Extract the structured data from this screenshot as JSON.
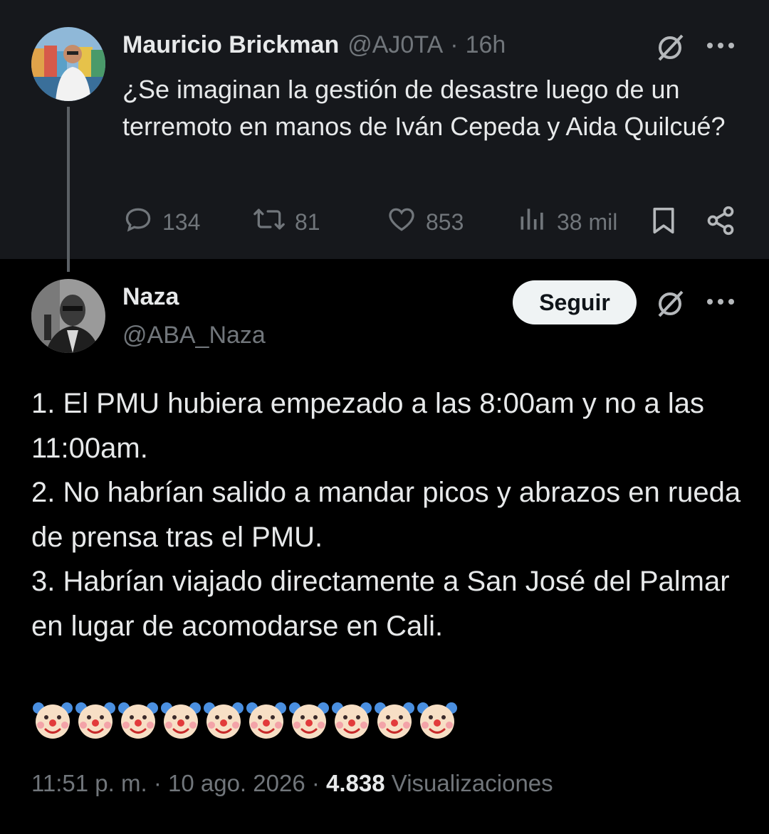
{
  "quoted_tweet": {
    "author_name": "Mauricio Brickman",
    "author_handle": "@AJ0TA",
    "separator": "·",
    "time": "16h",
    "text": "¿Se imaginan la gestión de desastre luego de un terremoto en manos de Iván Cepeda y Aida Quilcué?",
    "replies": "134",
    "reposts": "81",
    "likes": "853",
    "views": "38 mil",
    "icons": [
      "grok-icon",
      "more-icon",
      "reply-icon",
      "repost-icon",
      "like-icon",
      "views-icon",
      "bookmark-icon",
      "share-icon"
    ]
  },
  "main_tweet": {
    "author_name": "Naza",
    "author_handle": "@ABA_Naza",
    "follow_label": "Seguir",
    "lines": [
      "1. El PMU hubiera empezado a las 8:00am y no a las 11:00am.",
      "2. No habrían salido a mandar picos y abrazos en rueda de prensa tras el PMU.",
      "3. Habrían viajado directamente a San José del Palmar en lugar de acomodarse en Cali."
    ],
    "emoji_name": "clown-face",
    "emoji_count": 10,
    "timestamp": "11:51 p. m.",
    "separator": "·",
    "date": "10 ago. 2026",
    "views_count": "4.838",
    "views_label": "Visualizaciones"
  },
  "colors": {
    "background": "#000000",
    "quoted_background": "#16181c",
    "text_primary": "#e7e9ea",
    "text_secondary": "#71767b",
    "follow_button_bg": "#eff3f4"
  }
}
